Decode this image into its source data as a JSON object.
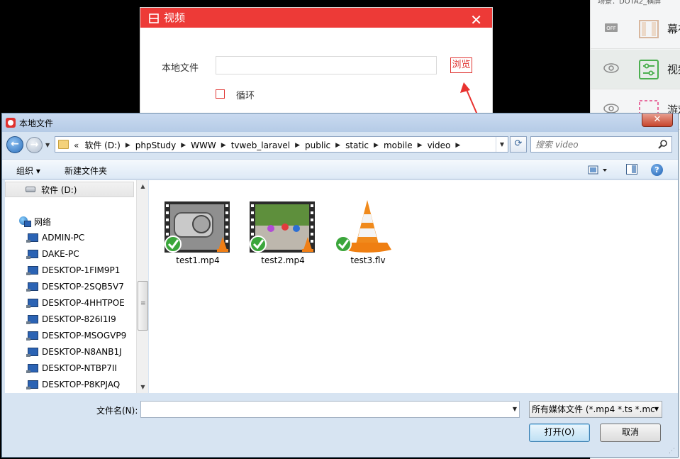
{
  "background": {
    "top_text": "场景：DOTA2_横屏",
    "sources": [
      {
        "label": "幕布",
        "icon": "curtain-icon",
        "visible_icon": "off-badge-icon"
      },
      {
        "label": "视频",
        "icon": "sliders-icon",
        "visible_icon": "eye-icon"
      },
      {
        "label": "游戏",
        "icon": "gamepad-icon",
        "visible_icon": "eye-icon"
      }
    ]
  },
  "video_dialog": {
    "title": "视频",
    "close": "✕",
    "local_file_label": "本地文件",
    "local_file_value": "",
    "browse_label": "浏览",
    "loop_label": "循环",
    "accent": "#ed3a37"
  },
  "file_dialog": {
    "title": "本地文件",
    "close": "✕",
    "breadcrumb_prefix": "«",
    "breadcrumbs": [
      "软件 (D:)",
      "phpStudy",
      "WWW",
      "tvweb_laravel",
      "public",
      "static",
      "mobile",
      "video"
    ],
    "search_placeholder": "搜索 video",
    "toolbar": {
      "organize": "组织 ▾",
      "new_folder": "新建文件夹",
      "help": "?"
    },
    "nav_items": [
      {
        "label": "软件 (D:)",
        "type": "drive"
      },
      {
        "label": "网络",
        "type": "network"
      },
      {
        "label": "ADMIN-PC",
        "type": "pc"
      },
      {
        "label": "DAKE-PC",
        "type": "pc"
      },
      {
        "label": "DESKTOP-1FIM9P1",
        "type": "pc"
      },
      {
        "label": "DESKTOP-2SQB5V7",
        "type": "pc"
      },
      {
        "label": "DESKTOP-4HHTPOE",
        "type": "pc"
      },
      {
        "label": "DESKTOP-826I1I9",
        "type": "pc"
      },
      {
        "label": "DESKTOP-MSOGVP9",
        "type": "pc"
      },
      {
        "label": "DESKTOP-N8ANB1J",
        "type": "pc"
      },
      {
        "label": "DESKTOP-NTBP7II",
        "type": "pc"
      },
      {
        "label": "DESKTOP-P8KPJAQ",
        "type": "pc"
      }
    ],
    "files": [
      {
        "name": "test1.mp4",
        "kind": "video-thumbnail-gears"
      },
      {
        "name": "test2.mp4",
        "kind": "video-thumbnail-people"
      },
      {
        "name": "test3.flv",
        "kind": "vlc-cone"
      }
    ],
    "filename_label": "文件名(N):",
    "filename_value": "",
    "filetype_value": "所有媒体文件 (*.mp4 *.ts *.mc",
    "open_label": "打开(O)",
    "cancel_label": "取消"
  }
}
